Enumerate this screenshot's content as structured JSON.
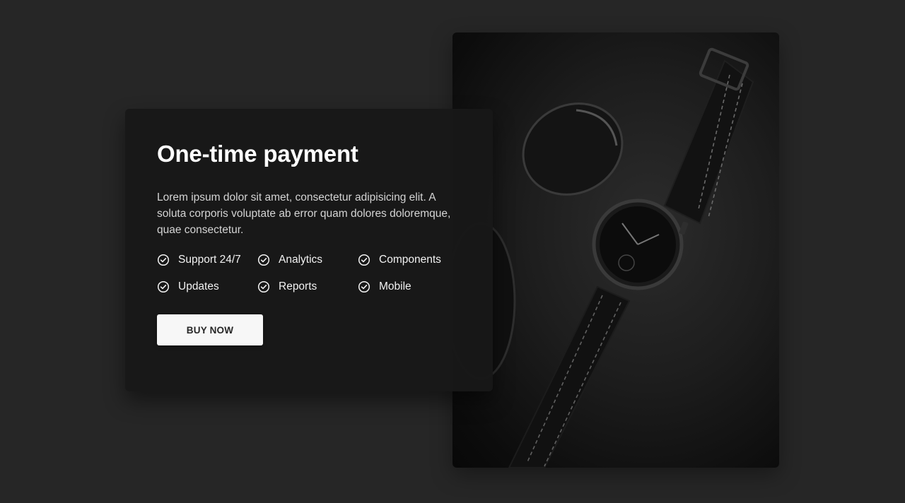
{
  "card": {
    "title": "One-time payment",
    "description": "Lorem ipsum dolor sit amet, consectetur adipisicing elit. A soluta corporis voluptate ab error quam dolores doloremque, quae consectetur.",
    "features": [
      {
        "label": "Support 24/7",
        "icon": "check-circle-icon"
      },
      {
        "label": "Analytics",
        "icon": "check-circle-icon"
      },
      {
        "label": "Components",
        "icon": "check-circle-icon"
      },
      {
        "label": "Updates",
        "icon": "check-circle-icon"
      },
      {
        "label": "Reports",
        "icon": "check-circle-icon"
      },
      {
        "label": "Mobile",
        "icon": "check-circle-icon"
      }
    ],
    "buy_label": "BUY NOW"
  },
  "photo": {
    "subject": "watch-and-sunglasses-photo"
  },
  "colors": {
    "background": "#262626",
    "card": "#181818",
    "button": "#f7f7f7",
    "text": "#ffffff"
  }
}
